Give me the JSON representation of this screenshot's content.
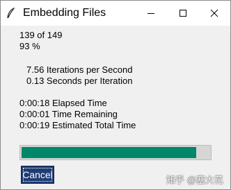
{
  "window": {
    "title": "Embedding Files",
    "icon": "feather-icon"
  },
  "stats": {
    "count": "139 of 149",
    "percent": "93 %",
    "iterations_per_second": "7.56 Iterations per Second",
    "seconds_per_iteration": "0.13 Seconds per Iteration",
    "elapsed": "0:00:18 Elapsed Time",
    "remaining": "0:00:01 Time Remaining",
    "total": "0:00:19 Estimated Total Time"
  },
  "progress": {
    "fraction": 0.93,
    "color": "#00876a"
  },
  "buttons": {
    "cancel_label": "Cancel"
  },
  "watermark": {
    "text": "知乎 @塞大花"
  }
}
